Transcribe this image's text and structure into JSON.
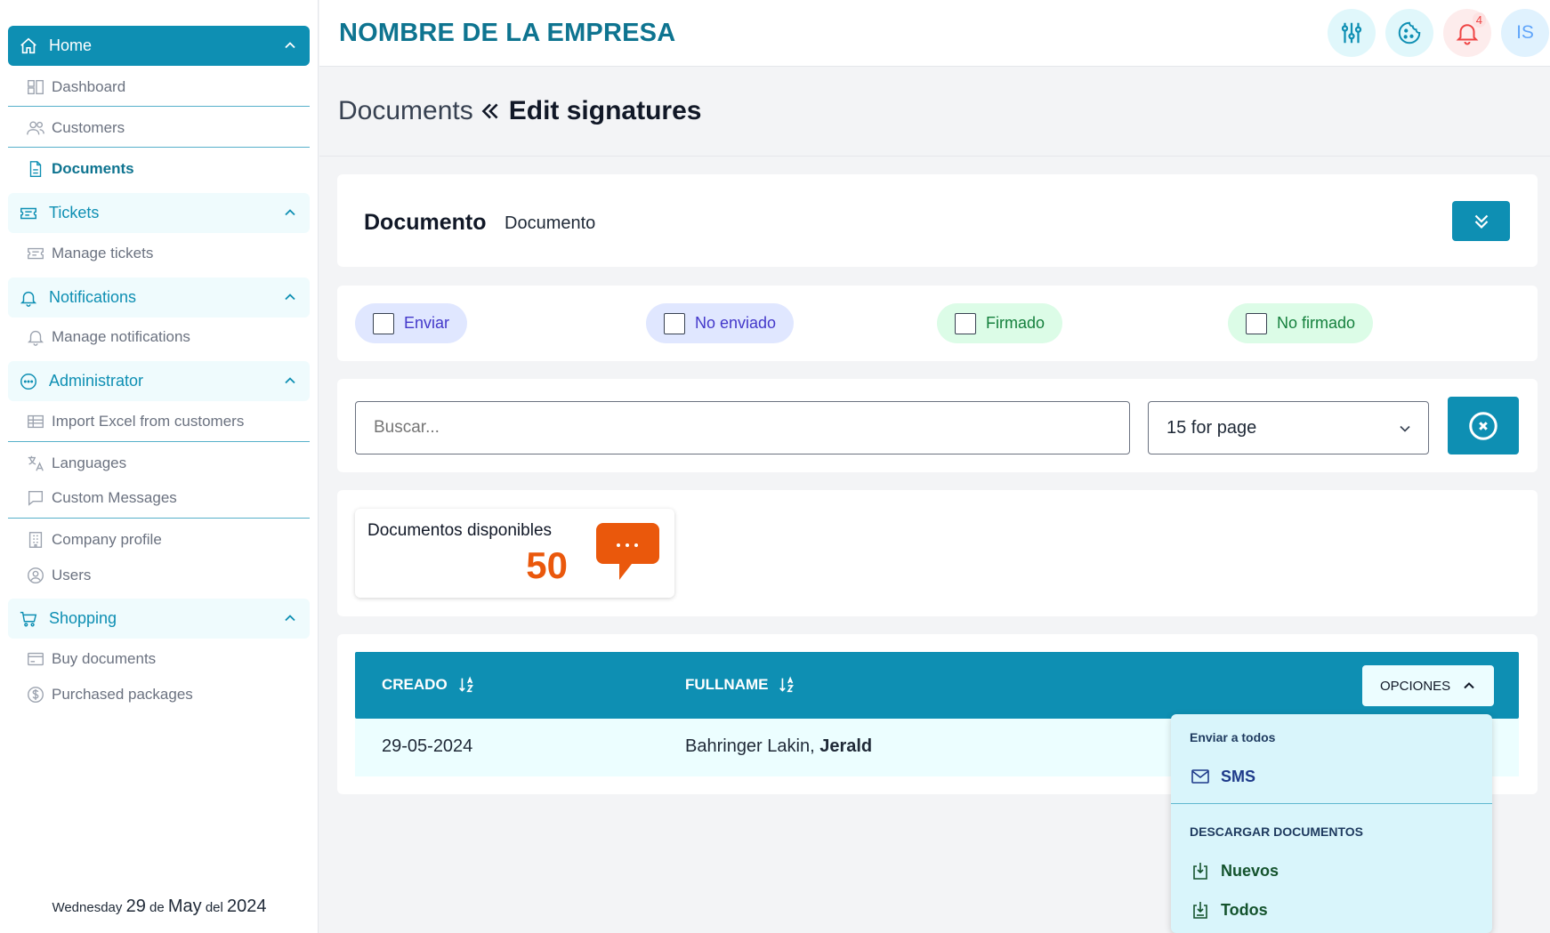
{
  "sidebar": {
    "groups": [
      {
        "label": "Home",
        "icon": "home-icon"
      },
      {
        "label": "Tickets",
        "icon": "ticket-icon"
      },
      {
        "label": "Notifications",
        "icon": "bell-icon"
      },
      {
        "label": "Administrator",
        "icon": "dots-circle-icon"
      },
      {
        "label": "Shopping",
        "icon": "cart-icon"
      }
    ],
    "items": [
      {
        "label": "Dashboard",
        "icon": "dashboard-icon"
      },
      {
        "label": "Customers",
        "icon": "users-icon"
      },
      {
        "label": "Documents",
        "icon": "document-icon"
      },
      {
        "label": "Manage tickets",
        "icon": "ticket-icon"
      },
      {
        "label": "Manage notifications",
        "icon": "bell-icon"
      },
      {
        "label": "Import Excel from customers",
        "icon": "table-icon"
      },
      {
        "label": "Languages",
        "icon": "translate-icon"
      },
      {
        "label": "Custom Messages",
        "icon": "chat-icon"
      },
      {
        "label": "Company profile",
        "icon": "building-icon"
      },
      {
        "label": "Users",
        "icon": "user-circle-icon"
      },
      {
        "label": "Buy documents",
        "icon": "credit-card-icon"
      },
      {
        "label": "Purchased packages",
        "icon": "dollar-icon"
      }
    ],
    "date": {
      "weekday": "Wednesday",
      "day": "29",
      "de": "de",
      "month": "May",
      "del": "del",
      "year": "2024"
    }
  },
  "header": {
    "company": "NOMBRE DE LA EMPRESA",
    "notification_count": "4",
    "avatar_initials": "IS"
  },
  "breadcrumb": {
    "parent": "Documents",
    "current": "Edit signatures"
  },
  "document": {
    "title": "Documento",
    "subtitle": "Documento"
  },
  "filters": [
    "Enviar",
    "No enviado",
    "Firmado",
    "No firmado"
  ],
  "search": {
    "placeholder": "Buscar...",
    "per_page": "15 for page"
  },
  "stat": {
    "label": "Documentos disponibles",
    "value": "50"
  },
  "table": {
    "columns": [
      "CREADO",
      "FULLNAME"
    ],
    "options_label": "OPCIONES",
    "rows": [
      {
        "created": "29-05-2024",
        "last_name": "Bahringer Lakin,",
        "first_name": "Jerald"
      }
    ]
  },
  "menu": {
    "send_header": "Enviar a todos",
    "sms": "SMS",
    "download_header": "DESCARGAR DOCUMENTOS",
    "new": "Nuevos",
    "all": "Todos"
  },
  "colors": {
    "primary": "#0e8fb3",
    "accent": "#ea580c",
    "danger": "#ef4444"
  }
}
